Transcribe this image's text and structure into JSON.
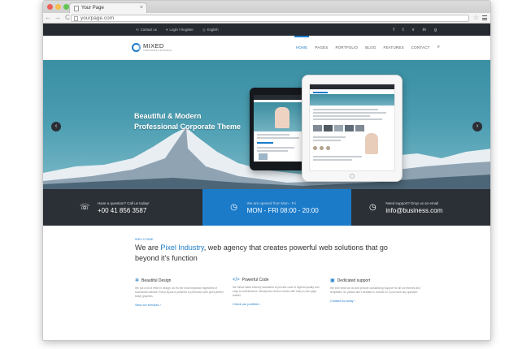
{
  "browser": {
    "tab_title": "Your Page",
    "url": "yourpage.com",
    "back": "←",
    "forward": "→",
    "reload": "C",
    "star": "☆",
    "close": "×"
  },
  "topbar": {
    "contact": "Contact us",
    "login": "Login / Register",
    "language": "English",
    "social": [
      "f",
      "t",
      "v",
      "in",
      "g"
    ]
  },
  "header": {
    "logo_title": "MIXED",
    "logo_tagline": "CORPORATE & BUSINESS",
    "nav": [
      "HOME",
      "PAGES",
      "PORTFOLIO",
      "BLOG",
      "FEATURES",
      "CONTACT"
    ],
    "search": "⌕"
  },
  "hero": {
    "heading_line1": "Beautiful & Modern",
    "heading_line2": "Professional Corporate Theme",
    "prev": "‹",
    "next": "›"
  },
  "info": [
    {
      "label": "Have a question? Call us today!",
      "value": "+00 41 856 3587",
      "icon": "☏"
    },
    {
      "label": "We are opened from Mon - Fri",
      "value": "MON - FRI 08:00 - 20:00",
      "icon": "◷"
    },
    {
      "label": "Need support? Drop us an email",
      "value": "info@business.com",
      "icon": "◷"
    }
  ],
  "welcome": {
    "kicker": "WELCOME",
    "lead_before": "We are ",
    "lead_accent": "Pixel Industry",
    "lead_after": ", web agency that creates powerful web solutions that go beyond it's function"
  },
  "features": [
    {
      "icon": "✻",
      "title": "Beautiful Design",
      "body": "We put a lot of effort in design, as it's the most important ingredient of successful website. Every layout is polished to perfection with pixel-perfect sharp graphics.",
      "link": "View our services  ›"
    },
    {
      "icon": "</>",
      "title": "Powerful Code",
      "body": "We follow latest industry standards to provide code of highest quality and easy to maintenance. Wordpress version comes with easy to use page builder.",
      "link": "Check our portfolio  ›"
    },
    {
      "icon": "▣",
      "title": "Dedicated support",
      "body": "We love what we do and provide outstanding Support for all our themes and templates. So please don't hesitate to contact us if you have any question.",
      "link": "Contact us today  ›"
    }
  ],
  "colors": {
    "accent": "#1b7bc9",
    "dark": "#2b3036",
    "topbar": "#262b31"
  }
}
